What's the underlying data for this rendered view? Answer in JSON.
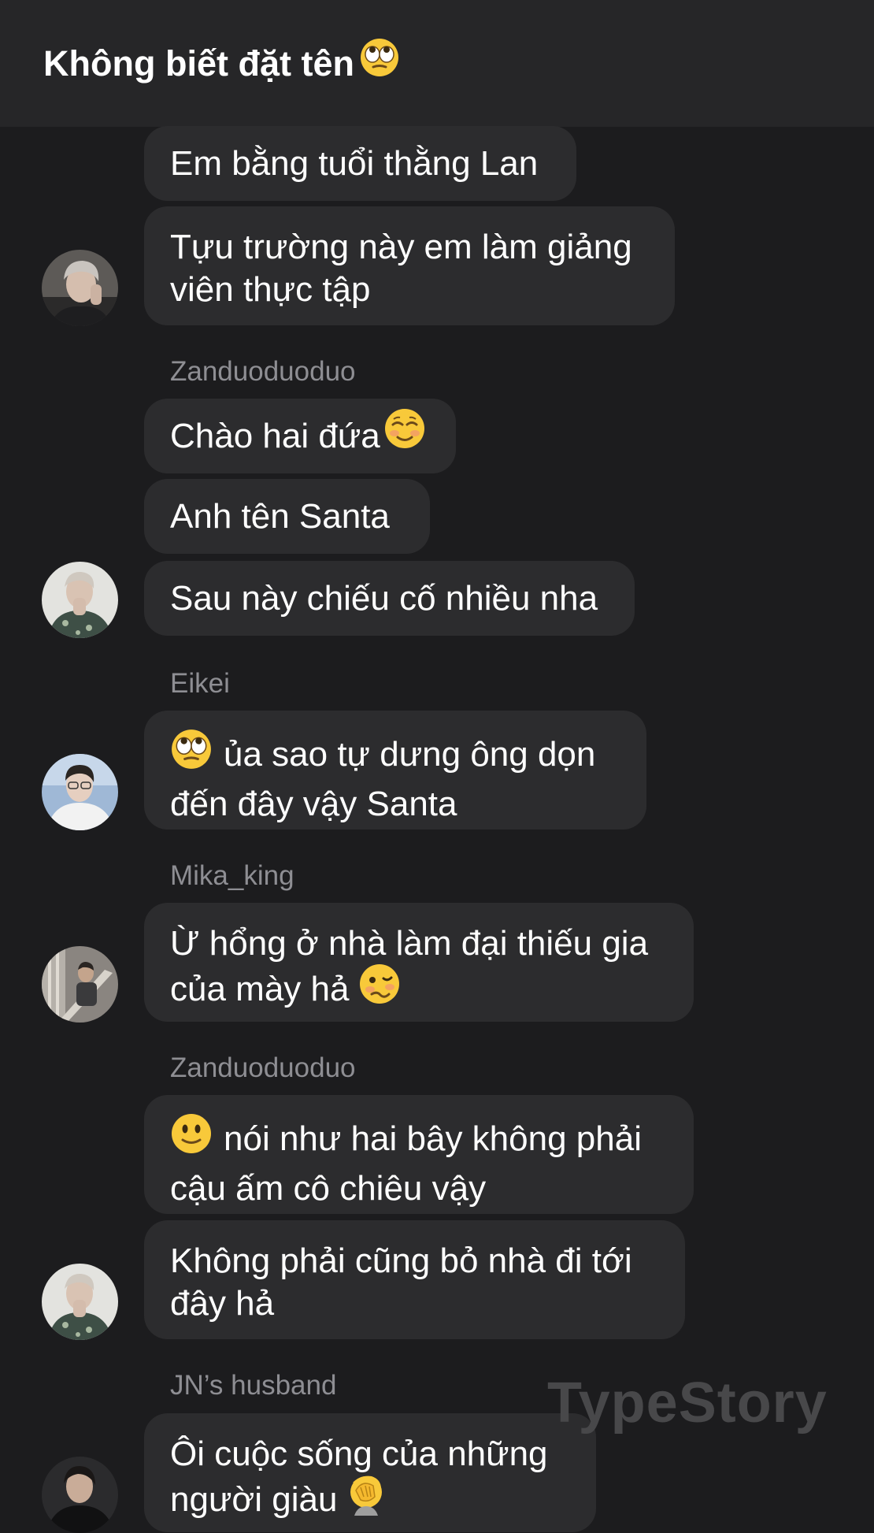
{
  "header": {
    "title": "Không biết đặt tên",
    "title_emoji": "eye-roll-emoji"
  },
  "messages": [
    {
      "lines": [
        "Em bằng tuổi thằng Lan"
      ]
    },
    {
      "lines": [
        "Tựu trường này em làm giảng",
        "viên thực tập"
      ]
    },
    {
      "sender": "Zanduoduoduo"
    },
    {
      "lines": [
        "Chào hai đứa"
      ],
      "emoji": "smiling-face-emoji"
    },
    {
      "lines": [
        "Anh tên Santa"
      ]
    },
    {
      "lines": [
        "Sau này chiếu cố nhiều nha"
      ]
    },
    {
      "sender": "Eikei"
    },
    {
      "lines": [
        "ủa sao tự dưng ông dọn",
        "đến đây vậy Santa"
      ],
      "emoji": "eye-roll-emoji"
    },
    {
      "sender": "Mika_king"
    },
    {
      "lines": [
        "Ừ hổng ở nhà làm đại thiếu gia",
        "của mày hả"
      ],
      "emoji": "woozy-face-emoji"
    },
    {
      "sender": "Zanduoduoduo"
    },
    {
      "lines": [
        "nói như hai bây không phải",
        "cậu ấm cô chiêu vậy"
      ],
      "emoji": "slight-smile-emoji"
    },
    {
      "lines": [
        "Không phải cũng bỏ nhà đi tới",
        "đây hả"
      ]
    },
    {
      "sender": "JN’s husband"
    },
    {
      "lines": [
        "Ôi cuộc sống của những",
        "người giàu"
      ],
      "emoji": "facepalm-emoji"
    }
  ],
  "watermark": "TypeStory"
}
